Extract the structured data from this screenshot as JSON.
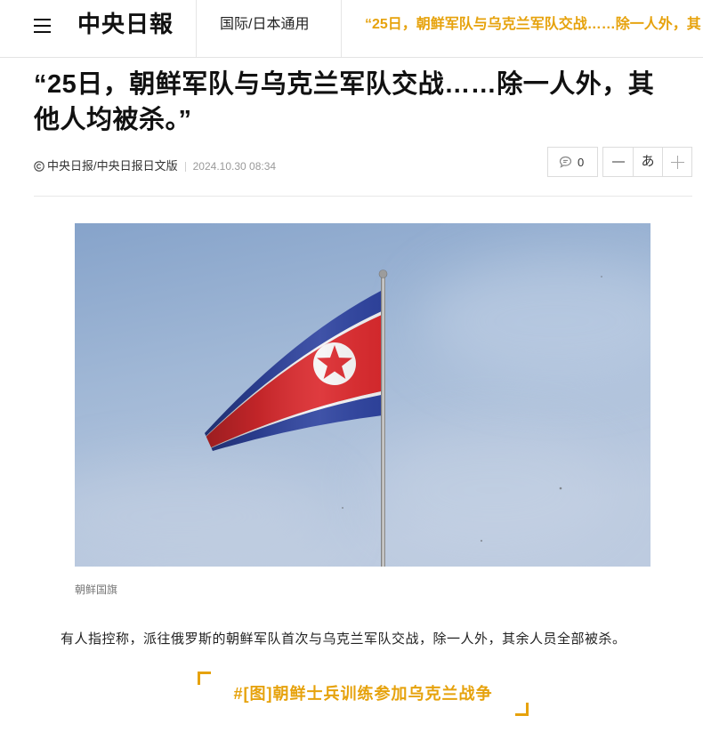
{
  "header": {
    "menu_icon": "hamburger-menu-icon",
    "logo": "中央日報",
    "section": "国际/日本通用",
    "ticker": "“25日，朝鲜军队与乌克兰军队交战……除一人外，其"
  },
  "article": {
    "headline": "“25日，朝鲜军队与乌克兰军队交战……除一人外，其他人均被杀。”",
    "byline": {
      "copyright_icon": "copyright-icon",
      "source": "中央日报/中央日报日文版",
      "date": "2024.10.30 08:34"
    },
    "tools": {
      "comment_icon": "comment-bubble-icon",
      "comment_count": 0,
      "font_decrease_icon": "minus-icon",
      "font_label": "あ",
      "font_increase_icon": "plus-icon"
    },
    "photo": {
      "caption": "朝鲜国旗"
    },
    "body": "有人指控称，派往俄罗斯的朝鲜军队首次与乌克兰军队交战，除一人外，其余人员全部被杀。",
    "related": "#[图]朝鲜士兵训练参加乌克兰战争"
  },
  "colors": {
    "accent": "#e6a20c",
    "text": "#111111",
    "muted": "#9a9a9a",
    "border": "#dcdcdc"
  }
}
